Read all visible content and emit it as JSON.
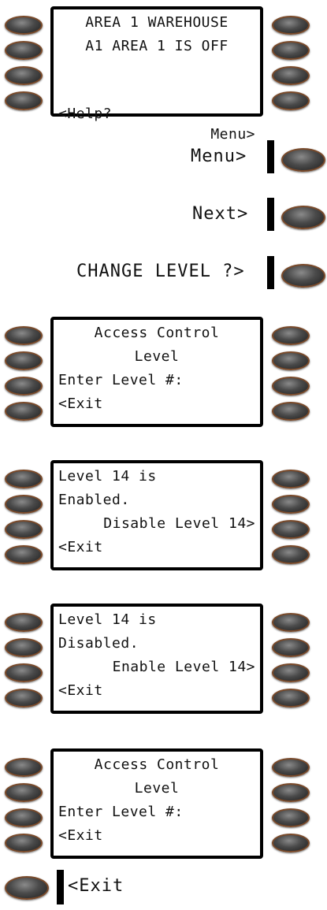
{
  "screens": [
    {
      "lines": [
        "AREA 1 WAREHOUSE",
        "A1 AREA 1 IS OFF",
        "",
        ""
      ],
      "left_soft": "<Help?",
      "right_soft": "Menu>"
    },
    {
      "lines": [
        "Access Control",
        "Level",
        "Enter Level #:",
        "<Exit"
      ]
    },
    {
      "lines": [
        "Level 14 is",
        "Enabled.",
        "Disable Level 14>",
        "<Exit"
      ]
    },
    {
      "lines": [
        "Level 14 is",
        "Disabled.",
        "Enable Level 14>",
        "<Exit"
      ]
    },
    {
      "lines": [
        "Access Control",
        "Level",
        "Enter Level #:",
        "<Exit"
      ]
    }
  ],
  "steps": [
    {
      "label": "Menu>"
    },
    {
      "label": "Next>"
    },
    {
      "label": "CHANGE LEVEL ?>"
    },
    {
      "label": "<Exit"
    }
  ]
}
